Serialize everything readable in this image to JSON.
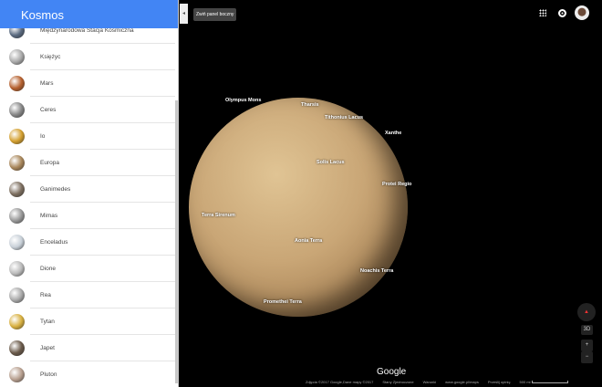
{
  "sidebar": {
    "title": "Kosmos",
    "items": [
      {
        "label": "Międzynarodowa Stacja Kosmiczna",
        "color": "#5a6a80"
      },
      {
        "label": "Księżyc",
        "color": "#aaa"
      },
      {
        "label": "Mars",
        "color": "#b5602e"
      },
      {
        "label": "Ceres",
        "color": "#888"
      },
      {
        "label": "Io",
        "color": "#d4a030"
      },
      {
        "label": "Europa",
        "color": "#a8865a"
      },
      {
        "label": "Ganimedes",
        "color": "#7d6f60"
      },
      {
        "label": "Mimas",
        "color": "#999"
      },
      {
        "label": "Enceladus",
        "color": "#c8d0d8"
      },
      {
        "label": "Dione",
        "color": "#bbb"
      },
      {
        "label": "Rea",
        "color": "#aaa"
      },
      {
        "label": "Tytan",
        "color": "#d8b040"
      },
      {
        "label": "Japet",
        "color": "#6a5a4a"
      },
      {
        "label": "Pluton",
        "color": "#b8a090"
      }
    ]
  },
  "collapse_tooltip": "Zwiń panel boczny",
  "map_labels": [
    "Olympus Mons",
    "Tharsis",
    "Tithonius Lacus",
    "Xanthe",
    "Solis Lacus",
    "Protei Regio",
    "Terra Sirenum",
    "Aonia Terra",
    "Noachis Terra",
    "Promethei Terra"
  ],
  "controls": {
    "mode_3d": "3D",
    "zoom_in": "+",
    "zoom_out": "−"
  },
  "logo": "Google",
  "footer": [
    "Zdjęcia ©2017 Google,Dane mapy ©2017",
    "Stany Zjednoczone",
    "Warunki",
    "www.google.pl/maps",
    "Prześlij opinię",
    "500 mi"
  ]
}
